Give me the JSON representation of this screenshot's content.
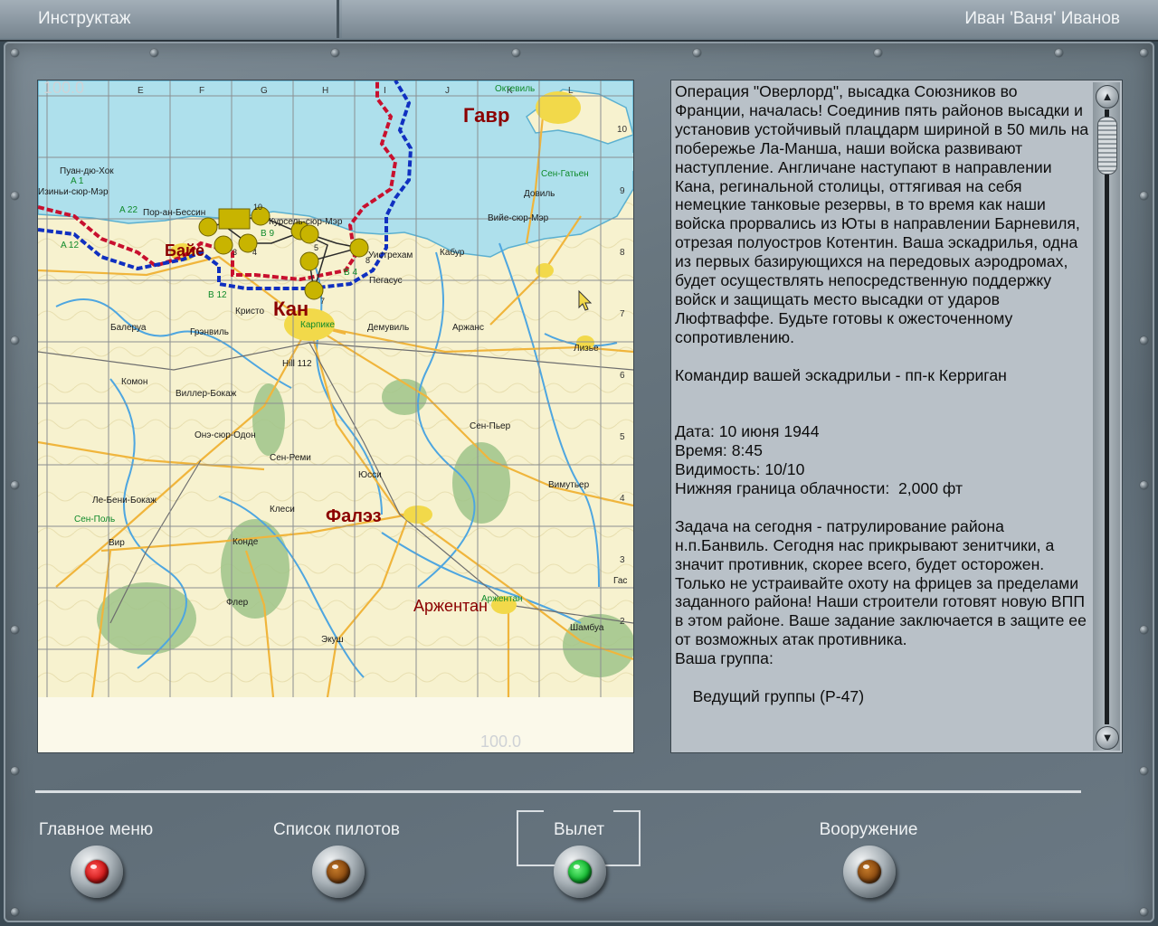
{
  "header": {
    "title": "Инструктаж",
    "user": "Иван 'Ваня' Иванов"
  },
  "map": {
    "corner_top": "100.0",
    "corner_bottom": "100.0",
    "col_labels": [
      "D",
      "E",
      "F",
      "G",
      "H",
      "I",
      "J",
      "K",
      "L"
    ],
    "row_labels": [
      "10",
      "9",
      "8",
      "7",
      "6",
      "5",
      "4",
      "3",
      "2"
    ],
    "cities": {
      "havre": "Гавр",
      "caen": "Кан",
      "bayeux": "Байе",
      "falaise": "Фалэз",
      "argentan": "Аржентан"
    },
    "towns": {
      "t1": "Пуан-дю-Хок",
      "t2": "Пор-ан-Бессин",
      "t3": "Курсель-сюр-Мэр",
      "t4": "Вийе-сюр-Мэр",
      "t5": "Довиль",
      "t6": "Сен-Гатьен",
      "t7": "Кабур",
      "t8": "Уистрехам",
      "t9": "Пегасус",
      "t10": "Кристо",
      "t11": "Карпике",
      "t12": "Демувиль",
      "t13": "Аржанс",
      "t14": "Балеруа",
      "t15": "Грэнвиль",
      "t16": "Лизье",
      "t17": "Hill 112",
      "t18": "Комон",
      "t19": "Виллер-Бокаж",
      "t20": "Онэ-сюр-Одон",
      "t21": "Сен-Реми",
      "t22": "Сен-Пьер",
      "t23": "Юсси",
      "t24": "Вимутьер",
      "t25": "Ле-Бени-Бокаж",
      "t26": "Клеси",
      "t27": "Сен-Поль",
      "t28": "Вир",
      "t29": "Конде",
      "t30": "Флер",
      "t31": "Аржентан",
      "t32": "Шамбуа",
      "t33": "Экуш",
      "t34": "Гас",
      "t35": "Октевиль",
      "t36": "Изиньи-сюр-Мэр"
    },
    "airfields": {
      "a1": "A 1",
      "a22": "A 22",
      "a12": "A 12",
      "b9": "B 9",
      "b4": "B 4",
      "b12": "B 12"
    },
    "waypoints": [
      "1",
      "2",
      "3",
      "4",
      "5",
      "6",
      "7",
      "8",
      "9",
      "10"
    ]
  },
  "briefing": {
    "text": "Операция \"Оверлорд\", высадка Союзников во Франции, началась! Соединив пять районов высадки и установив устойчивый плацдарм шириной в 50 миль на побережье Ла-Манша, наши войска развивают наступление. Англичане наступают в направлении Кана, регинальной столицы, оттягивая на себя немецкие танковые резервы, в то время как наши войска прорвались из Юты в направлении Барневиля, отрезая полуостров Котентин. Ваша эскадрилья, одна из первых базирующихся на передовых аэродромах, будет осуществлять непосредственную поддержку войск и защищать место высадки от ударов Люфтваффе. Будьте готовы к ожесточенному сопротивлению.\n\nКомандир вашей эскадрильи - пп-к Керриган\n\n\nДата: 10 июня 1944\nВремя: 8:45\nВидимость: 10/10\nНижняя граница облачности:  2,000 фт\n\nЗадача на сегодня - патрулирование района н.п.Банвиль. Сегодня нас прикрывают зенитчики, а значит противник, скорее всего, будет осторожен. Только не устраивайте охоту на фрицев за пределами заданного района! Наши строители готовят новую ВПП в этом районе. Ваше задание заключается в защите ее от возможных атак противника.\nВаша группа:\n\n    Ведущий группы (Р-47)"
  },
  "buttons": {
    "main_menu": "Главное меню",
    "pilot_list": "Список пилотов",
    "takeoff": "Вылет",
    "armament": "Вооружение"
  },
  "colors": {
    "sea": "#aee0ec",
    "land": "#f7f2cf",
    "city_label": "#8b0000",
    "route_red": "#c8102e",
    "route_blue": "#1030c0",
    "waypoint": "#c8b400",
    "lamp_red": "#d01818",
    "lamp_green": "#12b830",
    "lamp_brown": "#8a4a10"
  }
}
